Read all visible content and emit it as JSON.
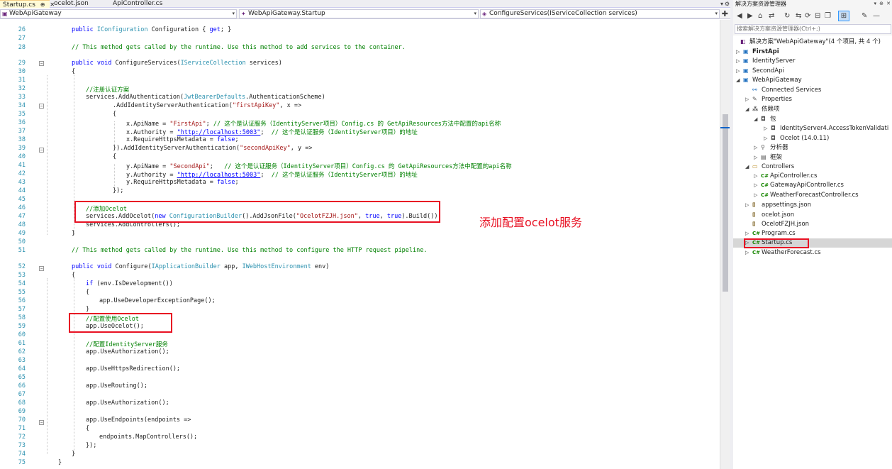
{
  "tabs": [
    {
      "label": "Startup.cs",
      "pin": "⊕",
      "close": "✕",
      "active": true
    },
    {
      "label": "ocelot.json",
      "active": false
    },
    {
      "label": "ApiController.cs",
      "active": false
    }
  ],
  "navbar": {
    "project": "WebApiGateway",
    "type": "WebApiGateway.Startup",
    "member": "ConfigureServices(IServiceCollection services)"
  },
  "editor": {
    "line_numbers": [
      "26",
      "27",
      "28",
      "29",
      "30",
      "31",
      "32",
      "33",
      "34",
      "35",
      "36",
      "37",
      "38",
      "39",
      "40",
      "41",
      "42",
      "43",
      "44",
      "45",
      "46",
      "47",
      "48",
      "49",
      "50",
      "51",
      "52",
      "53",
      "54",
      "55",
      "56",
      "57",
      "58",
      "59",
      "60",
      "61",
      "62",
      "63",
      "64",
      "65",
      "66",
      "67",
      "68",
      "69",
      "70",
      "71",
      "72",
      "73",
      "74",
      "75"
    ]
  },
  "annotation": {
    "text": "添加配置ocelot服务",
    "color": "#e81123"
  },
  "solution_explorer": {
    "title": "解决方案资源管理器",
    "search_placeholder": "搜索解决方案资源管理器(Ctrl+;)",
    "items": [
      {
        "label": "解决方案\"WebApiGateway\"(4 个项目, 共 4 个)",
        "icon": "solution-icon"
      },
      {
        "label": "FirstApi",
        "icon": "project-icon"
      },
      {
        "label": "IdentityServer",
        "icon": "project-icon"
      },
      {
        "label": "SecondApi",
        "icon": "project-icon"
      },
      {
        "label": "WebApiGateway",
        "icon": "project-icon"
      },
      {
        "label": "Connected Services",
        "icon": "connected-services-icon"
      },
      {
        "label": "Properties",
        "icon": "wrench-icon"
      },
      {
        "label": "依赖项",
        "icon": "dependencies-icon"
      },
      {
        "label": "包",
        "icon": "package-icon"
      },
      {
        "label": "IdentityServer4.AccessTokenValidati",
        "icon": "package-icon"
      },
      {
        "label": "Ocelot (14.0.11)",
        "icon": "package-icon"
      },
      {
        "label": "分析器",
        "icon": "analyzer-icon"
      },
      {
        "label": "框架",
        "icon": "framework-icon"
      },
      {
        "label": "Controllers",
        "icon": "folder-icon"
      },
      {
        "label": "ApiController.cs",
        "icon": "csharp-file-icon"
      },
      {
        "label": "GatewayApiController.cs",
        "icon": "csharp-file-icon"
      },
      {
        "label": "WeatherForecastController.cs",
        "icon": "csharp-file-icon"
      },
      {
        "label": "appsettings.json",
        "icon": "json-file-icon"
      },
      {
        "label": "ocelot.json",
        "icon": "json-file-icon"
      },
      {
        "label": "OcelotFZJH.json",
        "icon": "json-file-icon"
      },
      {
        "label": "Program.cs",
        "icon": "csharp-file-icon"
      },
      {
        "label": "Startup.cs",
        "icon": "csharp-file-icon"
      },
      {
        "label": "WeatherForecast.cs",
        "icon": "csharp-file-icon"
      }
    ]
  }
}
